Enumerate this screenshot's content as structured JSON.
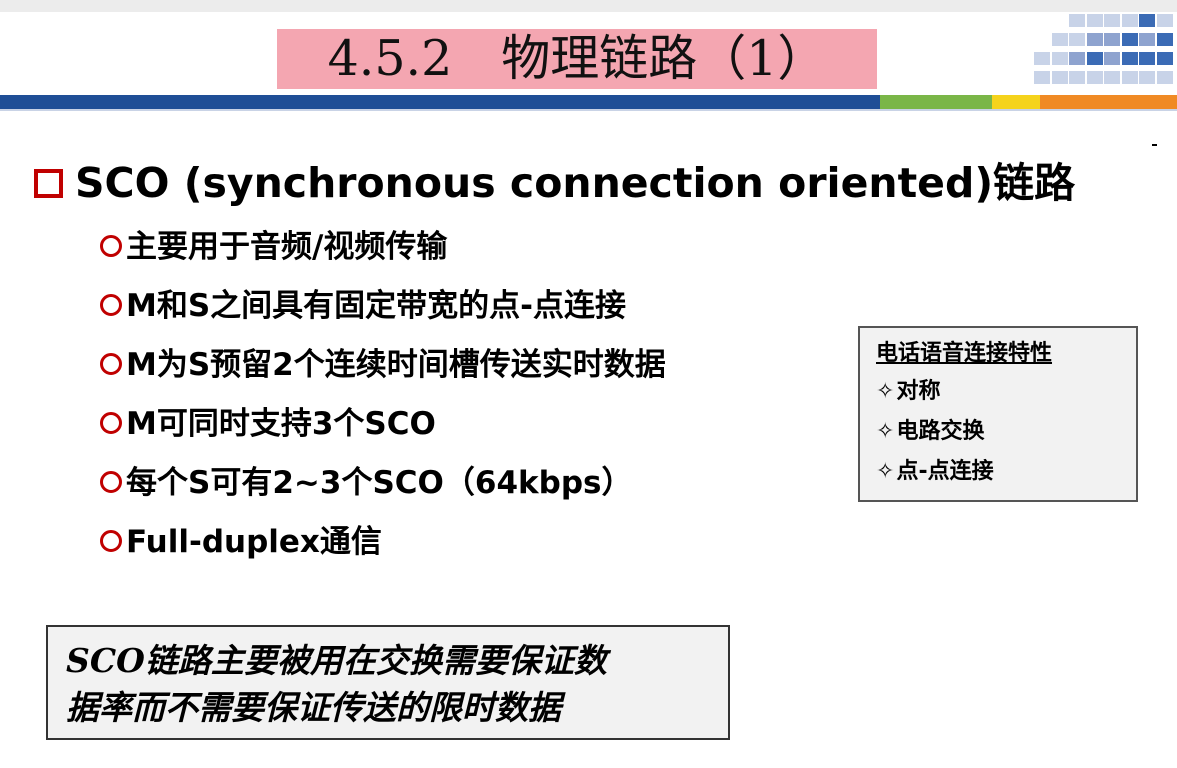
{
  "slide": {
    "title": "4.5.2　物理链路（1）",
    "heading": "SCO (synchronous connection oriented)链路",
    "bullets": [
      "主要用于音频/视频传输",
      "M和S之间具有固定带宽的点-点连接",
      "M为S预留2个连续时间槽传送实时数据",
      "M可同时支持3个SCO",
      "每个S可有2~3个SCO（64kbps）",
      "Full-duplex通信"
    ],
    "side_box": {
      "title": "电话语音连接特性",
      "bullet_glyph": "✧",
      "items": [
        "对称",
        "电路交换",
        "点-点连接"
      ]
    },
    "note_box": {
      "lines": [
        "SCO链路主要被用在交换需要保证数",
        "据率而不需要保证传送的限时数据"
      ]
    }
  },
  "colors": {
    "title_highlight": "#f4a6b1",
    "bullet_marker": "#c00000",
    "header_blue": "#1f4e96",
    "header_green": "#7ab648",
    "header_yellow": "#f5d31c",
    "header_orange": "#f08a24",
    "box_fill": "#f2f2f2"
  }
}
